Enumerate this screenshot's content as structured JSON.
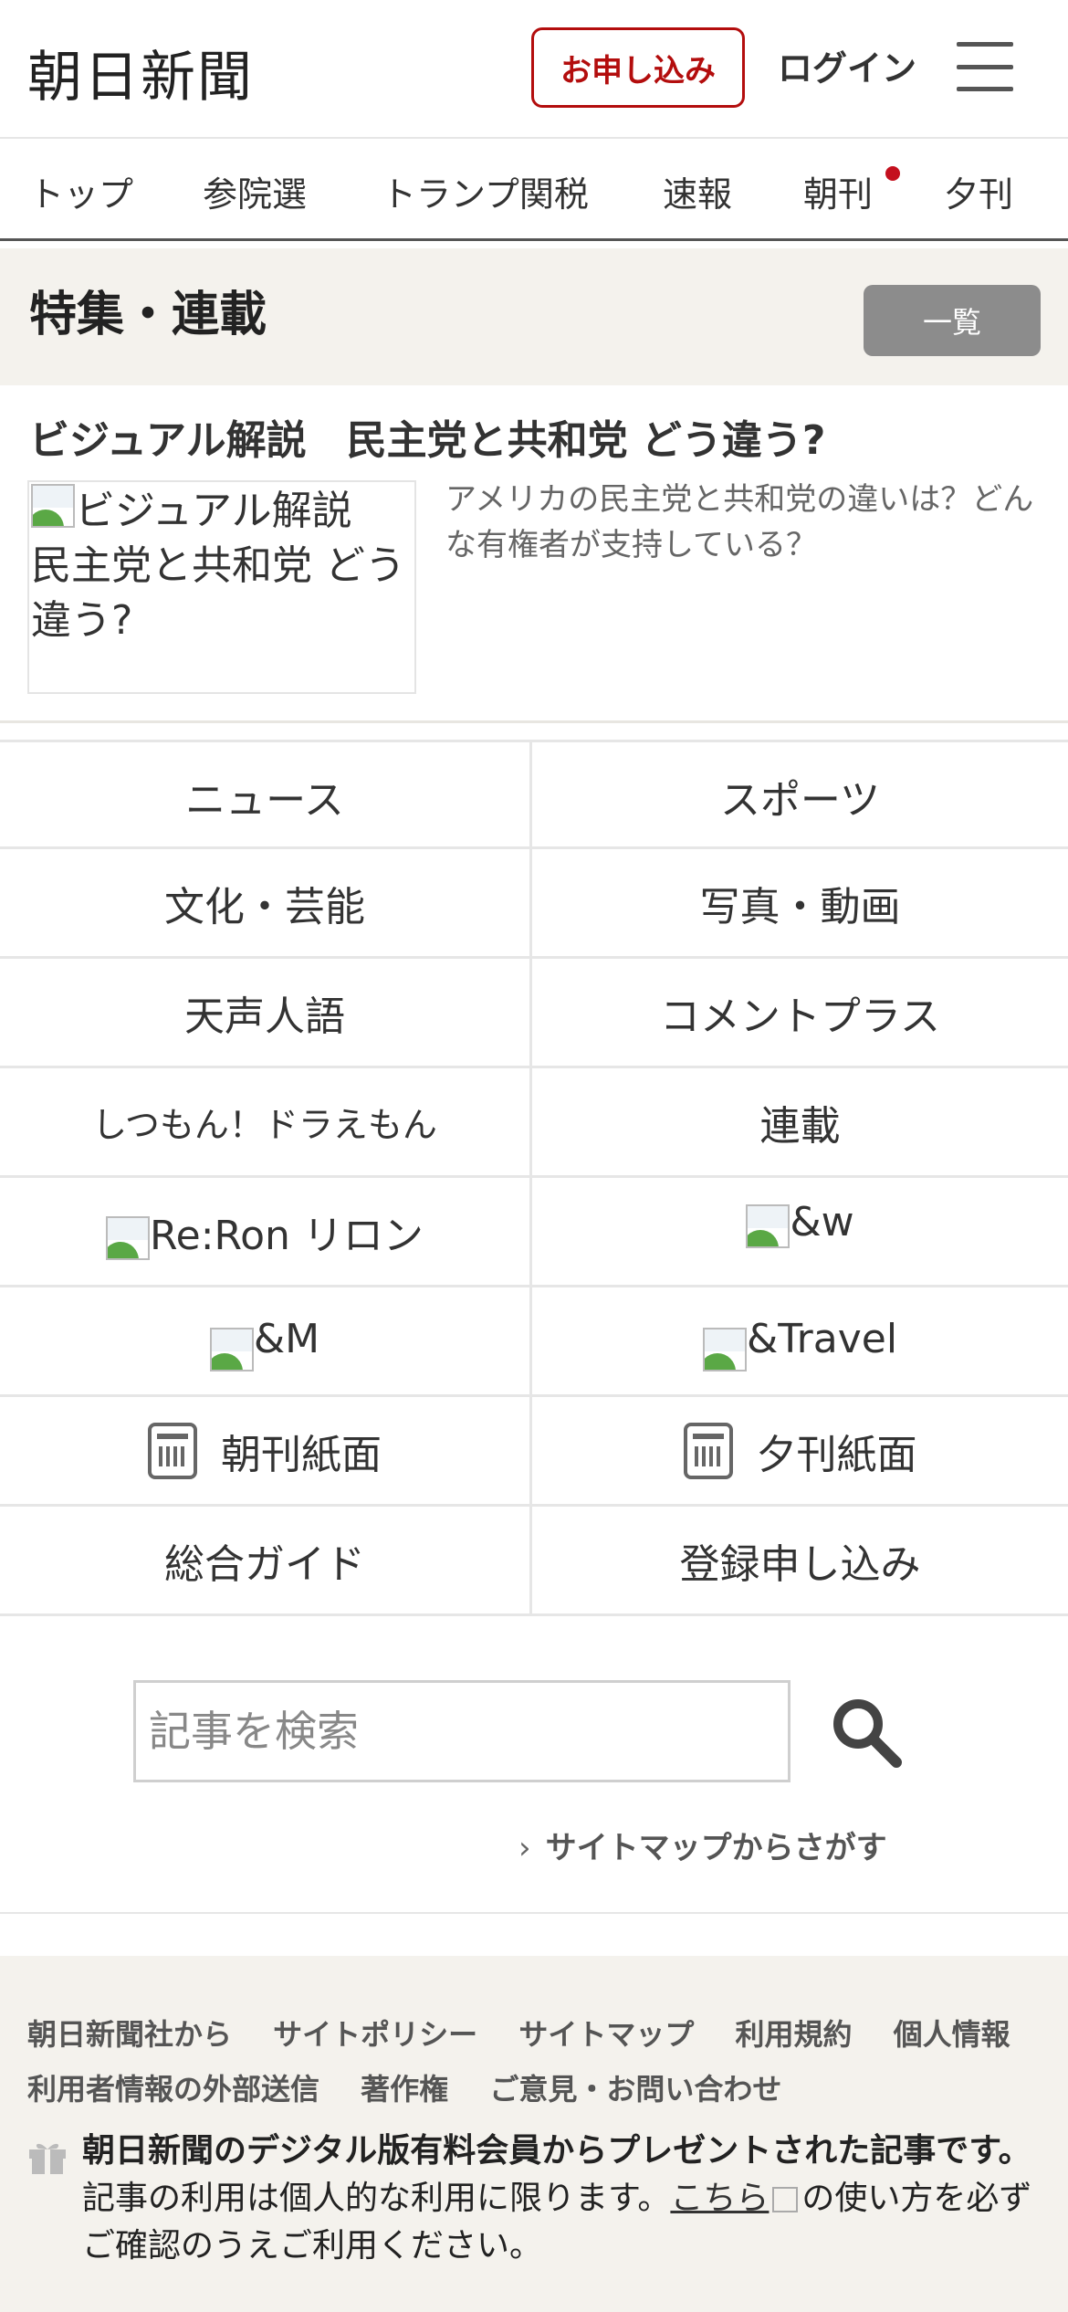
{
  "header": {
    "logo": "朝日新聞",
    "apply_label": "お申し込み",
    "login_label": "ログイン"
  },
  "nav": {
    "items": [
      "トップ",
      "参院選",
      "トランプ関税",
      "速報",
      "朝刊",
      "夕刊"
    ]
  },
  "feature": {
    "title": "特集・連載",
    "list_button": "一覧",
    "article": {
      "title": "ビジュアル解説　民主党と共和党 どう違う?",
      "image_alt": "ビジュアル解説　民主党と共和党 どう違う?",
      "description": "アメリカの民主党と共和党の違いは？どんな有権者が支持している？"
    }
  },
  "categories": {
    "rows": [
      [
        "ニュース",
        "スポーツ"
      ],
      [
        "文化・芸能",
        "写真・動画"
      ],
      [
        "天声人語",
        "コメントプラス"
      ],
      [
        "しつもん！ドラえもん",
        "連載"
      ],
      [
        "Re:Ron リロン",
        "&w"
      ],
      [
        "&M",
        "&Travel"
      ],
      [
        "朝刊紙面",
        "夕刊紙面"
      ],
      [
        "総合ガイド",
        "登録申し込み"
      ]
    ]
  },
  "search": {
    "placeholder": "記事を検索",
    "sitemap_link": "サイトマップからさがす"
  },
  "footer": {
    "links": [
      "朝日新聞社から",
      "サイトポリシー",
      "サイトマップ",
      "利用規約",
      "個人情報",
      "利用者情報の外部送信",
      "著作権",
      "ご意見・お問い合わせ"
    ],
    "gift_bold": "朝日新聞のデジタル版有料会員からプレゼントされた記事です。",
    "gift_text_1": "記事の利用は個人的な利用に限ります。",
    "gift_link": "こちら",
    "gift_text_2": "の使い方を必ずご確認のうえご利用ください。"
  },
  "colors": {
    "brand_red": "#b30d0d",
    "notification_dot": "#c4101e",
    "section_bg": "#f4f2ed",
    "button_gray": "#8c8c8c"
  },
  "icons": {
    "menu": "hamburger-icon",
    "search": "magnifier-icon",
    "morning_paper": "newspaper-sun-icon",
    "evening_paper": "newspaper-moon-icon",
    "gift": "gift-icon"
  }
}
